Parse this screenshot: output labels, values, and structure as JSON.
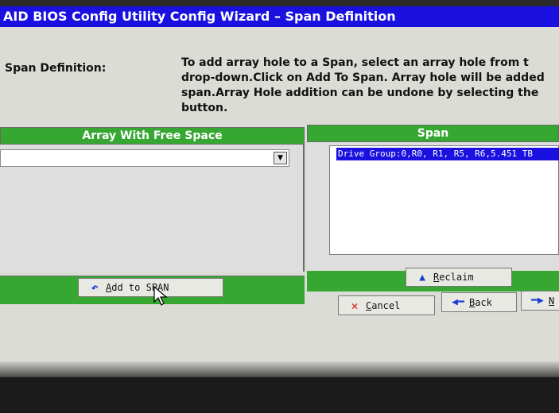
{
  "window": {
    "title": "AID BIOS Config Utility  Config Wizard – Span Definition"
  },
  "description": {
    "label": "Span Definition:",
    "lines": [
      "To add array hole to a Span, select an array hole from t",
      "drop-down.Click on Add To Span. Array hole will be added",
      "span.Array Hole addition can be undone by selecting the",
      "button."
    ]
  },
  "left_panel": {
    "header": "Array With Free Space",
    "select_value": "",
    "dropdown_glyph": "▼"
  },
  "right_panel": {
    "header": "Span",
    "items": [
      "Drive Group:0,R0, R1, R5, R6,5.451 TB"
    ]
  },
  "buttons": {
    "add_to_span": {
      "prefix": "",
      "accel": "A",
      "rest": "dd to SPAN",
      "icon": "undo-arrow-icon"
    },
    "reclaim": {
      "accel": "R",
      "rest": "eclaim",
      "icon": "up-arrow-icon"
    },
    "cancel": {
      "accel": "C",
      "rest": "ancel",
      "icon": "x-icon"
    },
    "back": {
      "accel": "B",
      "rest": "ack",
      "icon": "left-arrow-icon"
    },
    "next": {
      "accel": "N",
      "rest": "",
      "icon": "right-arrow-icon"
    }
  },
  "icons": {
    "undo": "↶",
    "up": "▲",
    "x": "✕",
    "left": "◀━",
    "right": "━▶"
  },
  "colors": {
    "title_bar": "#1a10e0",
    "header_green": "#36a832",
    "selection": "#1a10e0"
  }
}
